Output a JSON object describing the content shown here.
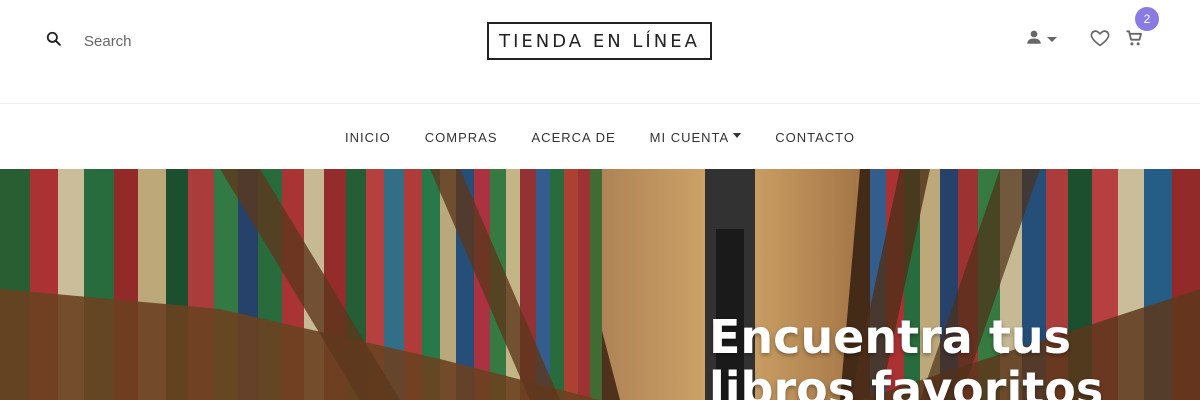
{
  "header": {
    "search": {
      "placeholder": "Search",
      "icon": "search-icon"
    },
    "logo": "TIENDA EN LÍNEA",
    "user_icon": "user-icon",
    "wishlist_icon": "heart-icon",
    "cart_icon": "cart-icon",
    "cart_count": "2"
  },
  "nav": {
    "items": [
      {
        "label": "INICIO"
      },
      {
        "label": "COMPRAS"
      },
      {
        "label": "ACERCA DE"
      },
      {
        "label": "MI CUENTA",
        "has_dropdown": true
      },
      {
        "label": "CONTACTO"
      }
    ]
  },
  "hero": {
    "title": "Encuentra tus libros favoritos"
  },
  "colors": {
    "badge": "#8a7be3",
    "text": "#222222"
  }
}
